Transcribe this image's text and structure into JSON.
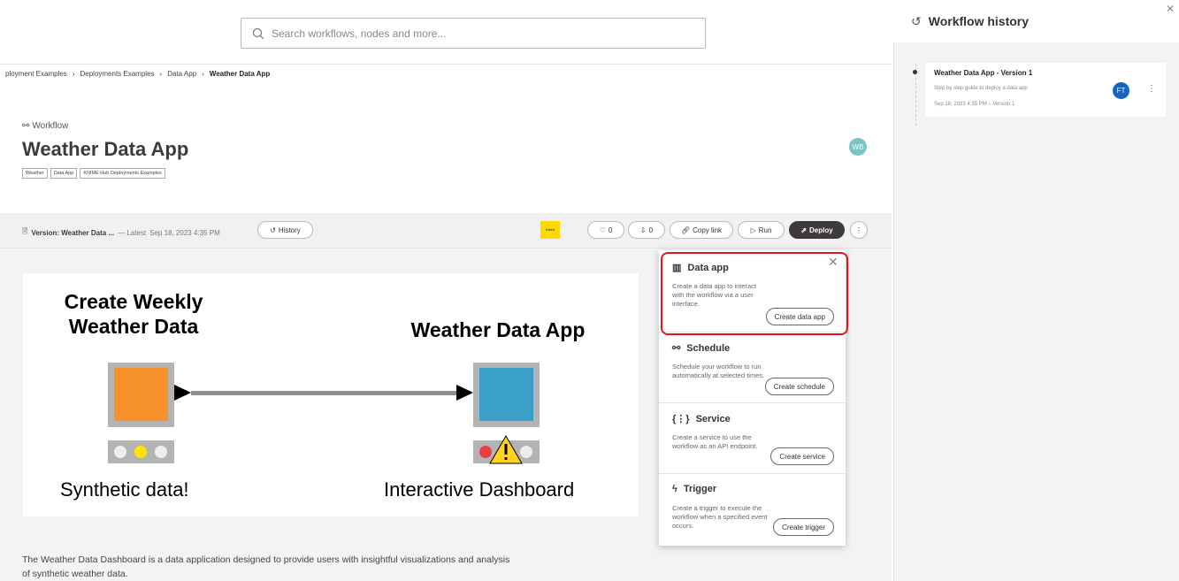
{
  "search": {
    "placeholder": "Search workflows, nodes and more..."
  },
  "breadcrumb": {
    "items": [
      "ployment Examples",
      "Deployments Examples",
      "Data App"
    ],
    "current": "Weather Data App"
  },
  "header": {
    "type_label": "Workflow",
    "title": "Weather Data App",
    "tags": [
      "Weather",
      "Data App",
      "KNIME Hub Deployments Examples"
    ],
    "owner_initials": "WB"
  },
  "version_bar": {
    "version_label": "Version: Weather Data ...",
    "latest": "— Latest",
    "date": "Sep 18, 2023 4:35 PM",
    "history_label": "History",
    "likes": "0",
    "downloads": "0",
    "copy_link_label": "Copy link",
    "run_label": "Run",
    "deploy_label": "Deploy"
  },
  "canvas": {
    "left_title_1": "Create Weekly",
    "left_title_2": "Weather Data",
    "left_label": "Synthetic data!",
    "right_title": "Weather Data App",
    "right_label": "Interactive Dashboard",
    "left_node_color": "#f7922a",
    "right_node_color": "#3aa0c8"
  },
  "description": "The Weather Data Dashboard is a data application designed to provide users with insightful visualizations and analysis of synthetic weather data.",
  "deploy_menu": {
    "items": [
      {
        "title": "Data app",
        "icon": "data-app-icon",
        "desc": "Create a data app to interact with the workflow via a user interface.",
        "button": "Create data app"
      },
      {
        "title": "Schedule",
        "icon": "schedule-icon",
        "desc": "Schedule your workflow to run automatically at selected times.",
        "button": "Create schedule"
      },
      {
        "title": "Service",
        "icon": "service-icon",
        "desc": "Create a service to use the workflow as an API endpoint.",
        "button": "Create service"
      },
      {
        "title": "Trigger",
        "icon": "trigger-icon",
        "desc": "Create a trigger to execute the workflow when a specified event occurs.",
        "button": "Create trigger"
      }
    ]
  },
  "history": {
    "title": "Workflow history",
    "entry": {
      "title": "Weather Data App - Version 1",
      "desc": "Step by step guide to deploy a data app",
      "date": "Sep 18, 2023 4:35 PM – Version 1",
      "initials": "FT"
    }
  },
  "colors": {
    "accent": "#3e3a39",
    "highlight": "#e3141b",
    "knime_yellow": "#ffd800"
  }
}
